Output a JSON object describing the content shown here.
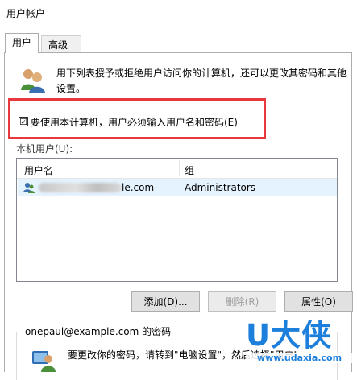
{
  "window": {
    "title": "用户帐户"
  },
  "tabs": [
    {
      "label": "用户",
      "active": true
    },
    {
      "label": "高级",
      "active": false
    }
  ],
  "description": "用下列表授予或拒绝用户访问你的计算机，还可以更改其密码和其他设置。",
  "require_login_checkbox": {
    "label": "要使用本计算机，用户必须输入用户名和密码(E)",
    "checked": true,
    "mark": "☑"
  },
  "users_group_label": "本机用户(U):",
  "users_table": {
    "columns": [
      "用户名",
      "组"
    ],
    "rows": [
      {
        "username_visible": "le.com",
        "group": "Administrators",
        "selected": true
      }
    ]
  },
  "buttons": {
    "add": "添加(D)...",
    "remove": "删除(R)",
    "properties": "属性(O)"
  },
  "password_section": {
    "title": "onepaul@example.com 的密码",
    "text": "要更改你的密码，请转到\"电脑设置\"，然后选择\"用户\"。"
  },
  "watermark": {
    "big": "U大侠",
    "small": "www.udaxia.com"
  },
  "colors": {
    "highlight_border": "#e8383d",
    "selected_row": "#e5f3ff",
    "watermark": "#1d7fdc"
  }
}
